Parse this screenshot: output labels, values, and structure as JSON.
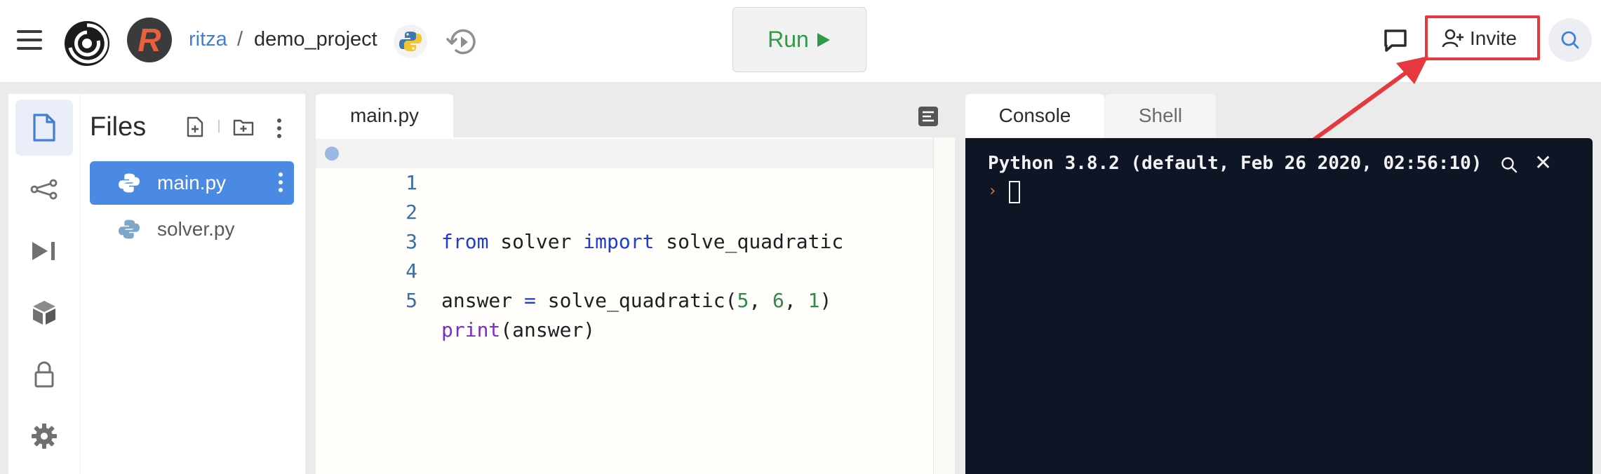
{
  "header": {
    "user": "ritza",
    "separator": "/",
    "project": "demo_project",
    "run_label": "Run",
    "invite_label": "Invite",
    "highlight_color": "#e5393f",
    "run_color": "#2f9a47"
  },
  "files_panel": {
    "title": "Files",
    "files": [
      {
        "name": "main.py",
        "active": true
      },
      {
        "name": "solver.py",
        "active": false
      }
    ]
  },
  "editor": {
    "tab": "main.py",
    "lines": [
      {
        "n": "1"
      },
      {
        "n": "2",
        "tokens": [
          "from",
          " solver ",
          "import",
          " solve_quadratic"
        ]
      },
      {
        "n": "3"
      },
      {
        "n": "4",
        "tokens": [
          "answer ",
          "=",
          " solve_quadratic(",
          "5",
          ", ",
          "6",
          ", ",
          "1",
          ")"
        ]
      },
      {
        "n": "5",
        "tokens": [
          "print",
          "(answer)"
        ]
      }
    ]
  },
  "console": {
    "tabs": [
      "Console",
      "Shell"
    ],
    "header": "Python 3.8.2 (default, Feb 26 2020, 02:56:10)",
    "prompt": "›"
  },
  "icons": {
    "rail": [
      "files-icon",
      "git-icon",
      "debugger-icon",
      "packages-icon",
      "secrets-icon",
      "settings-icon"
    ]
  }
}
